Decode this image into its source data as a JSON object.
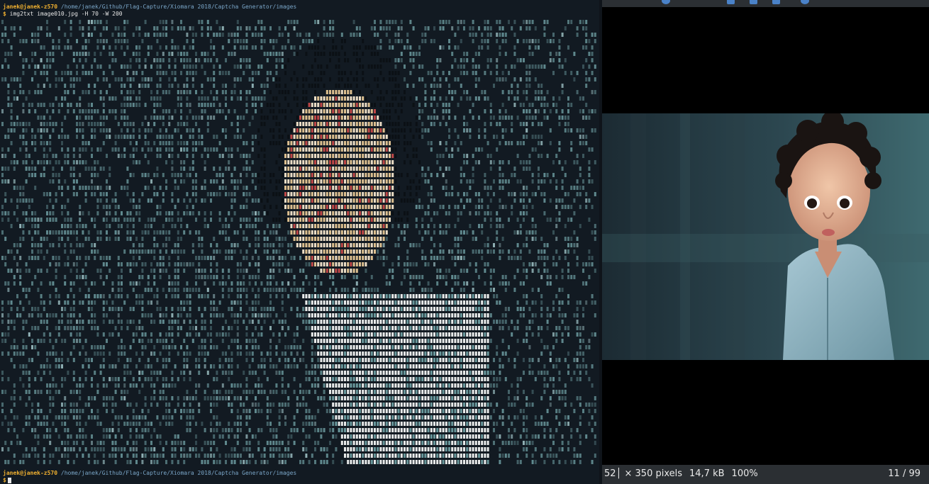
{
  "terminal": {
    "top_user": "janek@janek-z570",
    "top_path": "/home/janek/Github/Flag-Capture/Xiomara 2018/Captcha Generator/images",
    "prompt_symbol": "$",
    "command": "img2txt image010.jpg -H 70 -W 200",
    "bottom_user": "janek@janek-z570",
    "bottom_path": "/home/janek/Github/Flag-Capture/Xiomara 2018/Captcha Generator/images",
    "bottom_prompt": "$"
  },
  "viewer": {
    "dimensions": "52│ × 350 pixels",
    "file_size": "14,7 kB",
    "zoom": "100%",
    "position": "11 / 99"
  },
  "colors": {
    "terminal_bg": "#121a22",
    "prompt_user": "#f0b030",
    "prompt_path": "#7aa6c8",
    "ascii_teal": "#6f9fa3",
    "ascii_skin": "#e8c896",
    "ascii_red": "#c84a4a",
    "ascii_white": "#f4f6f6",
    "viewer_bg": "#000000",
    "statusbar_bg": "#2b2f33"
  },
  "icons": [
    "terminal-cursor-icon",
    "viewer-toolbar-icon"
  ]
}
